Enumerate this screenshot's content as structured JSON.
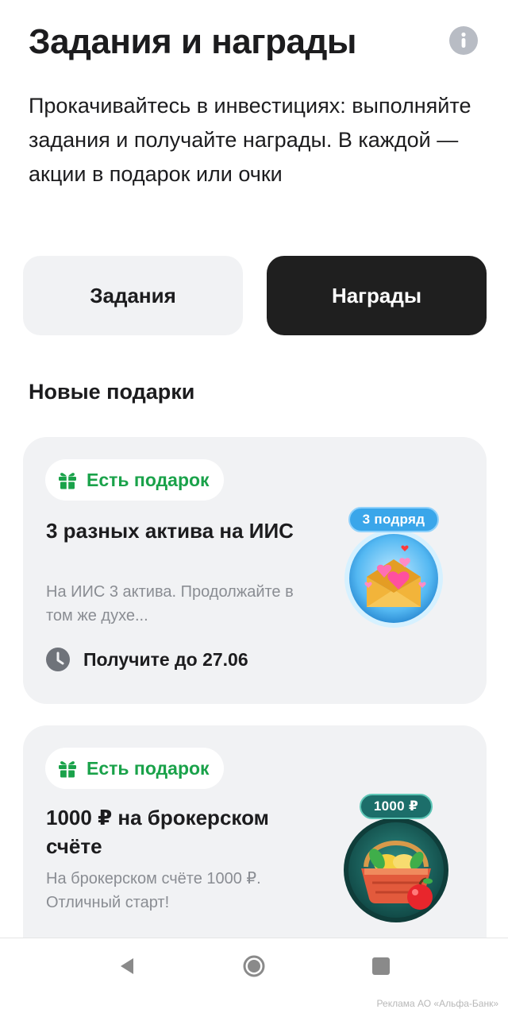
{
  "header": {
    "title": "Задания и награды",
    "info_icon": "info-icon",
    "subtitle": "Прокачивайтесь в инвестициях: выполняйте задания и получайте награды. В каждой — акции в подарок или очки"
  },
  "tabs": [
    {
      "label": "Задания",
      "active": false
    },
    {
      "label": "Награды",
      "active": true
    }
  ],
  "section": {
    "title": "Новые подарки"
  },
  "cards": [
    {
      "badge": "Есть подарок",
      "badge_icon": "gift-icon",
      "title": "3 разных актива на ИИС",
      "description": "На ИИС 3 актива. Продолжайте в том же духе...",
      "deadline": "Получите до 27.06",
      "deadline_icon": "clock-icon",
      "reward_label": "3 подряд",
      "reward_image": "envelope-hearts-image"
    },
    {
      "badge": "Есть подарок",
      "badge_icon": "gift-icon",
      "title": "1000 ₽ на брокерском счёте",
      "description": "На брокерском счёте 1000 ₽. Отличный старт!",
      "reward_label": "1000 ₽",
      "reward_image": "basket-image"
    }
  ],
  "navbar": {
    "back_icon": "back-icon",
    "home_icon": "home-icon",
    "recents_icon": "recents-icon"
  },
  "ad_text": "Реклама АО «Альфа-Банк»",
  "colors": {
    "accent_green": "#1aa24a",
    "active_tab": "#1f1f1f",
    "card_bg": "#f1f2f4",
    "streak_blue": "#3aa6ea",
    "streak_teal": "#1c6e6a"
  }
}
